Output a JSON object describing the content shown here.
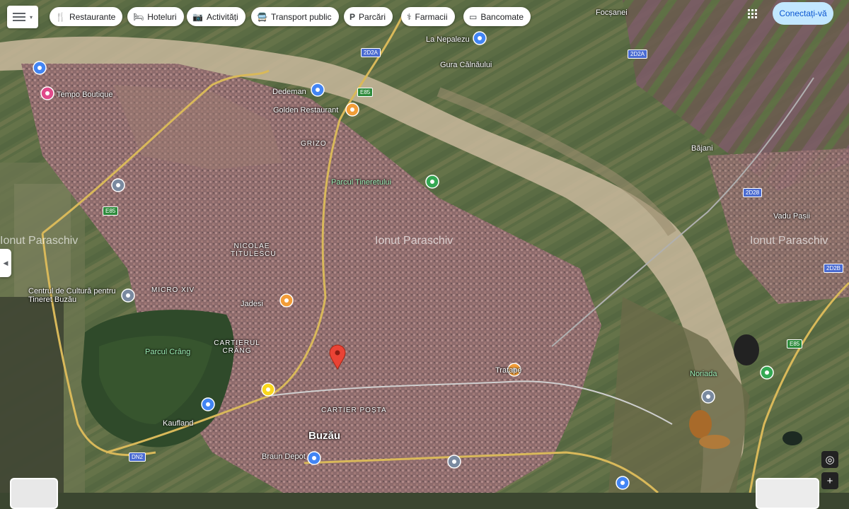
{
  "chips": [
    {
      "label": "Restaurante",
      "icon": "fork-knife-icon"
    },
    {
      "label": "Hoteluri",
      "icon": "bed-icon"
    },
    {
      "label": "Activități",
      "icon": "camera-icon"
    },
    {
      "label": "Transport public",
      "icon": "bus-icon"
    },
    {
      "label": "Parcări",
      "icon": "parking-icon"
    },
    {
      "label": "Farmacii",
      "icon": "pharmacy-icon"
    },
    {
      "label": "Bancomate",
      "icon": "atm-icon"
    }
  ],
  "header": {
    "connect_label": "Conectați-vă"
  },
  "watermark": "Ionut Paraschiv",
  "places": {
    "focsanei": "Focșanei",
    "la_nepalezu": "La Nepalezu",
    "gura_calnaului": "Gura Călnăului",
    "bajani": "Băjani",
    "vadu_pasii": "Vadu Pașii",
    "gorza": "GRIZO",
    "nicolae_titulescu": "NICOLAE TITULESCU",
    "micro_xiv": "MICRO XIV",
    "crang": "CARTIERUL CRÂNG",
    "cartier_posta": "CARTIER POȘTA",
    "buzau": "Buzău",
    "kaufland": "Kaufland",
    "jadesi": "Jadesi",
    "tratape": "Tratape",
    "brau_depot": "Braun Depot",
    "tempo_boutique": "Tempo Boutique",
    "dedeman": "Dedeman",
    "golden_restaurant": "Golden Restaurant",
    "centrul_cultural": "Centrul de Cultură pentru Tineret Buzău",
    "parcul_crang": "Parcul Crâng",
    "parcul_central": "Parcul Tineretului",
    "noriada": "Noriada"
  },
  "roads": {
    "r1": "2D2A",
    "r2": "2D2A",
    "r3": "E85",
    "r4": "2D28",
    "r5": "2D2B",
    "r6": "E85",
    "r7": "DN2",
    "r8": "E85"
  }
}
